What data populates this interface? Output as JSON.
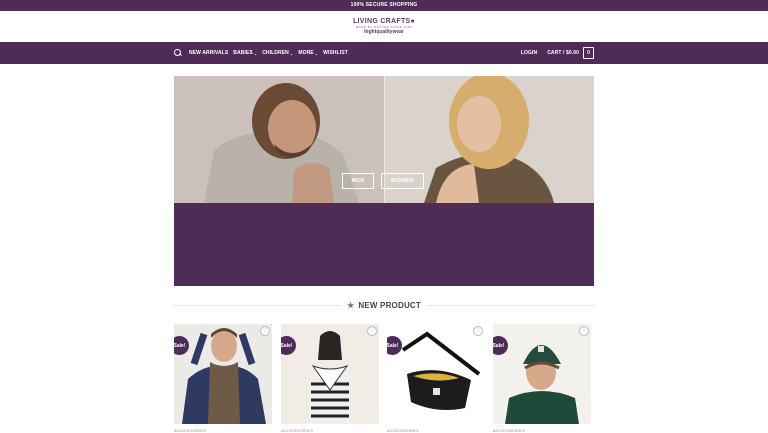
{
  "topbar": {
    "text": "100% SECURE SHOPPING"
  },
  "brand": {
    "name": "LIVING CRAFTS",
    "mark": "●",
    "tagline": "MADE BY NATURE SINCE 1986",
    "subline": "hightqualitywear"
  },
  "nav": {
    "items": [
      {
        "label": "NEW ARRIVALS",
        "has_dropdown": false
      },
      {
        "label": "BABIES",
        "has_dropdown": true
      },
      {
        "label": "CHILDREN",
        "has_dropdown": true
      },
      {
        "label": "MORE",
        "has_dropdown": true
      },
      {
        "label": "WISHLIST",
        "has_dropdown": false
      }
    ],
    "login": "LOGIN",
    "cart": "CART / $0.00",
    "cart_count": "0",
    "search_icon": "search-icon",
    "chevron": "⌄"
  },
  "hero": {
    "buttons": [
      {
        "label": "MEN"
      },
      {
        "label": "WOMEN"
      }
    ]
  },
  "section": {
    "title": "NEW PRODUCT",
    "icon": "star-icon",
    "star": "★"
  },
  "products": [
    {
      "badge": "Sale!",
      "category": "ACCESSORIES",
      "wish": "♡"
    },
    {
      "badge": "Sale!",
      "category": "ACCESSORIES",
      "wish": "♡"
    },
    {
      "badge": "Sale!",
      "category": "ACCESSORIES",
      "wish": "♡"
    },
    {
      "badge": "Sale!",
      "category": "ACCESSORIES",
      "wish": "♡"
    }
  ],
  "colors": {
    "brand_purple": "#4f2c57",
    "white": "#ffffff"
  }
}
